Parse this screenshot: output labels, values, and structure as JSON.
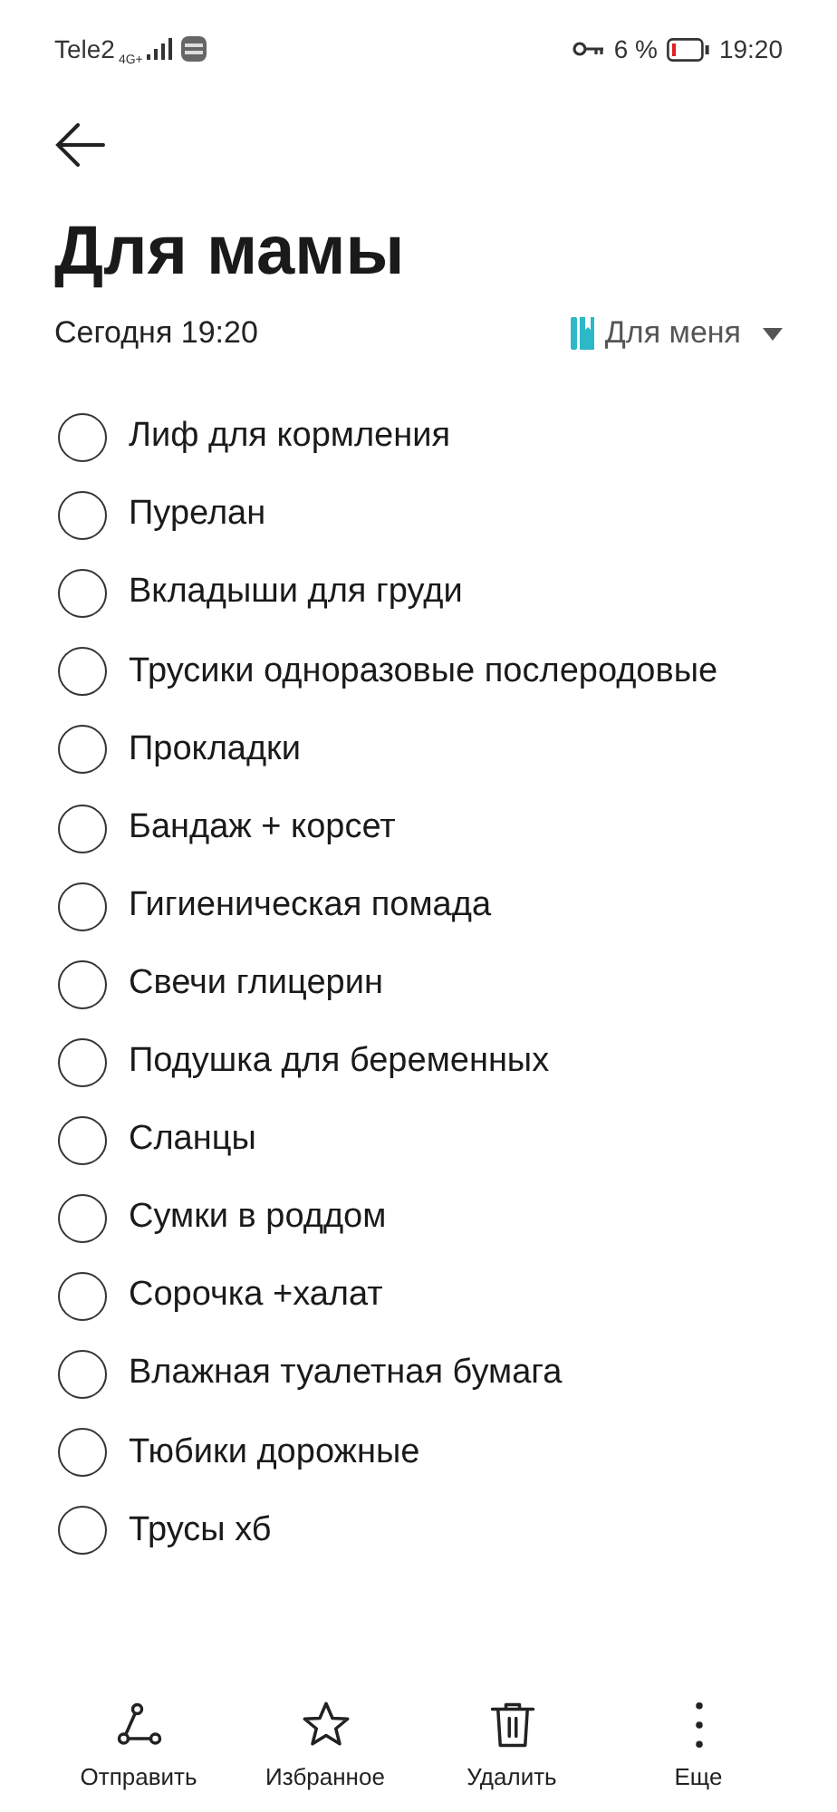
{
  "status_bar": {
    "carrier": "Tele2",
    "network": "4G+",
    "battery": "6 %",
    "time": "19:20"
  },
  "title": "Для мамы",
  "date": "Сегодня 19:20",
  "folder": {
    "label": "Для меня"
  },
  "items": [
    {
      "text": "Лиф для кормления",
      "checked": false
    },
    {
      "text": "Пурелан",
      "checked": false
    },
    {
      "text": "Вкладыши для груди",
      "checked": false
    },
    {
      "text": "Трусики одноразовые послеродовые",
      "checked": false
    },
    {
      "text": "Прокладки",
      "checked": false
    },
    {
      "text": "Бандаж + корсет",
      "checked": false
    },
    {
      "text": "Гигиеническая помада",
      "checked": false
    },
    {
      "text": "Свечи глицерин",
      "checked": false
    },
    {
      "text": "Подушка для беременных",
      "checked": false
    },
    {
      "text": "Сланцы",
      "checked": false
    },
    {
      "text": "Сумки в роддом",
      "checked": false
    },
    {
      "text": "Сорочка +халат",
      "checked": false
    },
    {
      "text": "Влажная туалетная бумага",
      "checked": false
    },
    {
      "text": "Тюбики дорожные",
      "checked": false
    },
    {
      "text": "Трусы хб",
      "checked": false
    }
  ],
  "toolbar": [
    {
      "kind": "share",
      "label": "Отправить"
    },
    {
      "kind": "star",
      "label": "Избранное"
    },
    {
      "kind": "delete",
      "label": "Удалить"
    },
    {
      "kind": "more",
      "label": "Еще"
    }
  ]
}
